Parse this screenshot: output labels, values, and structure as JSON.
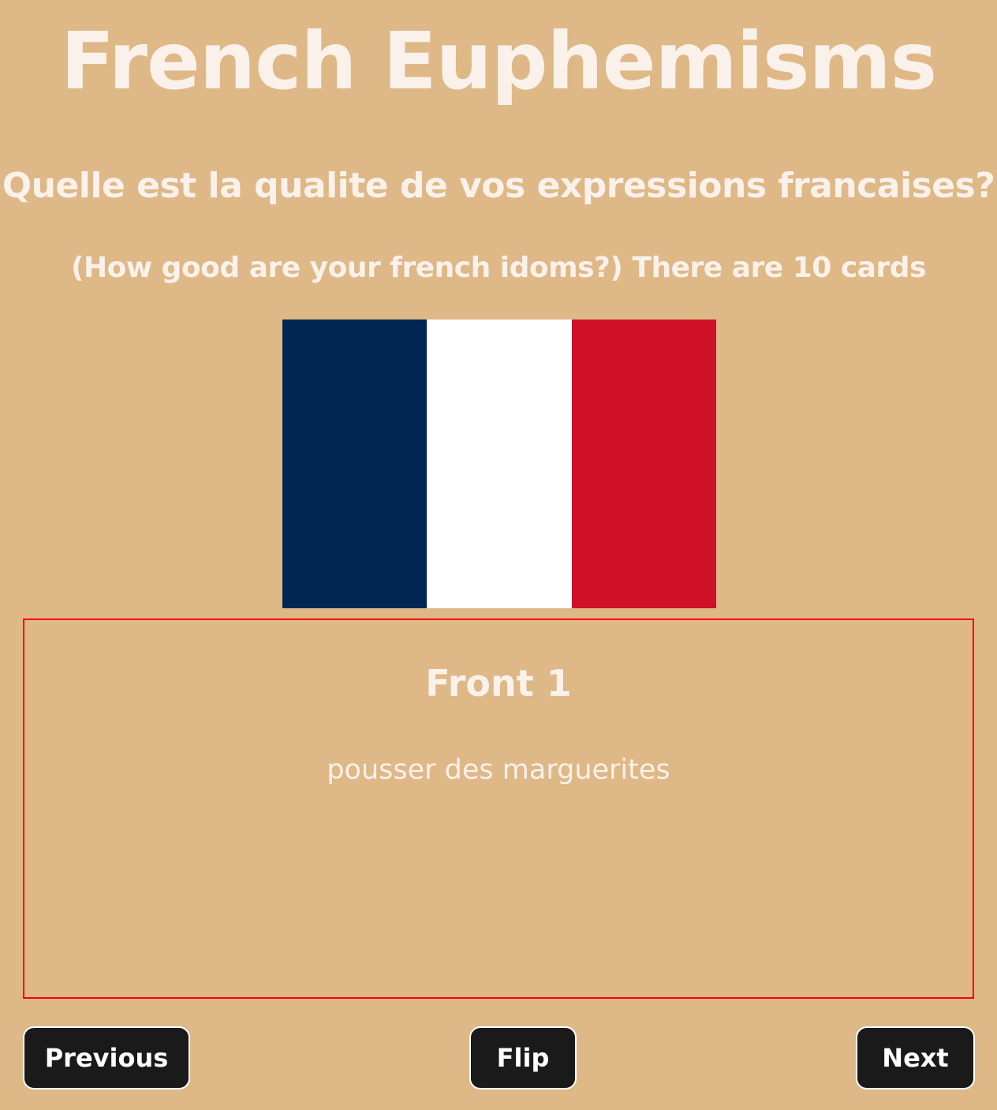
{
  "header": {
    "title": "French Euphemisms",
    "subtitle": "Quelle est la qualite de vos expressions francaises?",
    "description": "(How good are your french idoms?) There are 10 cards"
  },
  "flag": {
    "stripes": [
      "#002654",
      "#ffffff",
      "#ce1126"
    ]
  },
  "card": {
    "title": "Front 1",
    "text": "pousser des marguerites"
  },
  "controls": {
    "previous_label": "Previous",
    "flip_label": "Flip",
    "next_label": "Next"
  },
  "colors": {
    "background": "#deb887",
    "text": "#faf1ea",
    "card_border": "#ff0000",
    "button_bg": "#1a1a1a"
  }
}
